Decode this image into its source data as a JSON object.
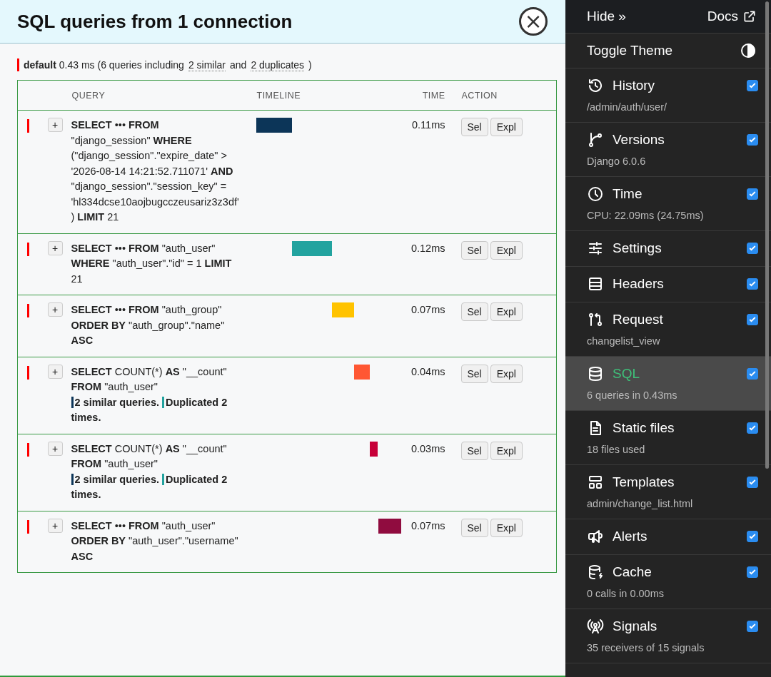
{
  "panel": {
    "title": "SQL queries from 1 connection",
    "close_label": "×"
  },
  "summary": {
    "before": "**default** 0.43 ms (6 queries including",
    "similar_link": "2 similar",
    "middle": "and",
    "duplicates_link": "2 duplicates",
    "after": ")"
  },
  "table": {
    "columns": [
      "QUERY",
      "TIMELINE",
      "TIME",
      "ACTION"
    ],
    "rows": [
      {
        "expand": "+",
        "query": "**SELECT** ••• **FROM** \"django_session\" **WHERE** (\"django_session\".\"expire_date\" > '2026-08-14 14:21:52.711071' **AND** \"django_session\".\"session_key\" = 'hl334dcse10aojbugcczeusariz3z3df') **LIMIT** 21",
        "time": "0.11ms",
        "color": "#0c3558",
        "actions": [
          "Sel",
          "Expl"
        ]
      },
      {
        "expand": "+",
        "query": "**SELECT** ••• **FROM** \"auth_user\" **WHERE** \"auth_user\".\"id\" = 1 **LIMIT** 21",
        "time": "0.12ms",
        "color": "#22a39f",
        "actions": [
          "Sel",
          "Expl"
        ]
      },
      {
        "expand": "+",
        "query": "**SELECT** ••• **FROM** \"auth_group\" **ORDER BY** \"auth_group\".\"name\" **ASC**",
        "time": "0.07ms",
        "color": "#ffc300",
        "actions": [
          "Sel",
          "Expl"
        ]
      },
      {
        "expand": "+",
        "query": "**SELECT** COUNT(*) **AS** \"__count\" **FROM** \"auth_user\"",
        "similar": "2 similar queries.",
        "duplicated": "Duplicated 2 times.",
        "time": "0.04ms",
        "color": "#ff5733",
        "actions": [
          "Sel",
          "Expl"
        ]
      },
      {
        "expand": "+",
        "query": "**SELECT** COUNT(*) **AS** \"__count\" **FROM** \"auth_user\"",
        "similar": "2 similar queries.",
        "duplicated": "Duplicated 2 times.",
        "time": "0.03ms",
        "color": "#c70039",
        "actions": [
          "Sel",
          "Expl"
        ]
      },
      {
        "expand": "+",
        "query": "**SELECT** ••• **FROM** \"auth_user\" **ORDER BY** \"auth_user\".\"username\" **ASC**",
        "time": "0.07ms",
        "color": "#900c3f",
        "actions": [
          "Sel",
          "Expl"
        ]
      }
    ]
  },
  "toolbar": {
    "hide": "Hide »",
    "docs": "Docs",
    "toggle_theme": "Toggle Theme",
    "panels": [
      {
        "title": "History",
        "subtitle": "/admin/auth/user/",
        "checked": true,
        "selected": false
      },
      {
        "title": "Versions",
        "subtitle": "Django 6.0.6",
        "checked": true,
        "selected": false
      },
      {
        "title": "Time",
        "subtitle": "CPU: 22.09ms (24.75ms)",
        "checked": true,
        "selected": false
      },
      {
        "title": "Settings",
        "checked": true,
        "selected": false
      },
      {
        "title": "Headers",
        "checked": true,
        "selected": false
      },
      {
        "title": "Request",
        "subtitle": "changelist_view",
        "checked": true,
        "selected": false
      },
      {
        "title": "SQL",
        "subtitle": "6 queries in 0.43ms",
        "checked": true,
        "selected": true
      },
      {
        "title": "Static files",
        "subtitle": "18 files used",
        "checked": true,
        "selected": false
      },
      {
        "title": "Templates",
        "subtitle": "admin/change_list.html",
        "checked": true,
        "selected": false
      },
      {
        "title": "Alerts",
        "checked": true,
        "selected": false
      },
      {
        "title": "Cache",
        "subtitle": "0 calls in 0.00ms",
        "checked": true,
        "selected": false
      },
      {
        "title": "Signals",
        "subtitle": "35 receivers of 15 signals",
        "checked": true,
        "selected": false
      }
    ]
  }
}
